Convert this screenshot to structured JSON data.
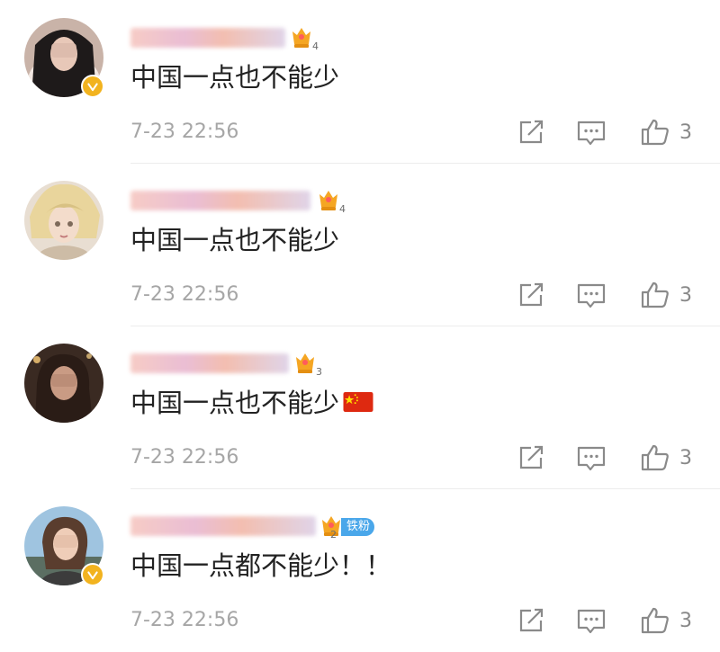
{
  "comments": [
    {
      "text": "中国一点也不能少",
      "timestamp": "7-23 22:56",
      "likes": "3",
      "level": "4",
      "verified": true
    },
    {
      "text": "中国一点也不能少",
      "timestamp": "7-23 22:56",
      "likes": "3",
      "level": "4",
      "verified": false
    },
    {
      "text": "中国一点也不能少",
      "timestamp": "7-23 22:56",
      "likes": "3",
      "level": "3",
      "verified": false,
      "emoji": "china-flag"
    },
    {
      "text": "中国一点都不能少！！",
      "timestamp": "7-23 22:56",
      "likes": "3",
      "level": "2",
      "verified": true,
      "fan_tag": "铁粉"
    }
  ],
  "colors": {
    "verified_badge": "#f2b31f",
    "level_badge": "#f5a623",
    "fan_tag": "#4aa7ea",
    "flag_red": "#de2910",
    "flag_star": "#ffde00"
  },
  "icons": {
    "share": "share-icon",
    "reply": "comment-icon",
    "like": "thumbs-up-icon",
    "verified": "verified-badge-icon",
    "level": "fan-level-badge-icon",
    "flag": "china-flag-icon"
  }
}
